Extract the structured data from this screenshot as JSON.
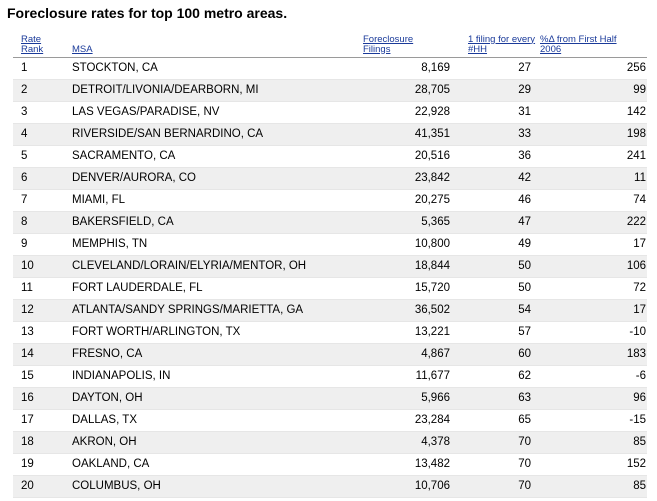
{
  "title": "Foreclosure rates for top 100 metro areas.",
  "columns": {
    "rank": "Rate\nRank",
    "msa": "MSA",
    "filings": "Foreclosure\nFilings",
    "per_hh": "1 filing for every\n#HH",
    "pct_change": "%Δ from First Half\n2006"
  },
  "rows": [
    {
      "rank": "1",
      "msa": "STOCKTON, CA",
      "filings": "8,169",
      "per_hh": "27",
      "pct_change": "256"
    },
    {
      "rank": "2",
      "msa": "DETROIT/LIVONIA/DEARBORN, MI",
      "filings": "28,705",
      "per_hh": "29",
      "pct_change": "99"
    },
    {
      "rank": "3",
      "msa": "LAS VEGAS/PARADISE, NV",
      "filings": "22,928",
      "per_hh": "31",
      "pct_change": "142"
    },
    {
      "rank": "4",
      "msa": "RIVERSIDE/SAN BERNARDINO, CA",
      "filings": "41,351",
      "per_hh": "33",
      "pct_change": "198"
    },
    {
      "rank": "5",
      "msa": "SACRAMENTO, CA",
      "filings": "20,516",
      "per_hh": "36",
      "pct_change": "241"
    },
    {
      "rank": "6",
      "msa": "DENVER/AURORA, CO",
      "filings": "23,842",
      "per_hh": "42",
      "pct_change": "11"
    },
    {
      "rank": "7",
      "msa": "MIAMI, FL",
      "filings": "20,275",
      "per_hh": "46",
      "pct_change": "74"
    },
    {
      "rank": "8",
      "msa": "BAKERSFIELD, CA",
      "filings": "5,365",
      "per_hh": "47",
      "pct_change": "222"
    },
    {
      "rank": "9",
      "msa": "MEMPHIS, TN",
      "filings": "10,800",
      "per_hh": "49",
      "pct_change": "17"
    },
    {
      "rank": "10",
      "msa": "CLEVELAND/LORAIN/ELYRIA/MENTOR, OH",
      "filings": "18,844",
      "per_hh": "50",
      "pct_change": "106"
    },
    {
      "rank": "11",
      "msa": "FORT LAUDERDALE, FL",
      "filings": "15,720",
      "per_hh": "50",
      "pct_change": "72"
    },
    {
      "rank": "12",
      "msa": "ATLANTA/SANDY SPRINGS/MARIETTA, GA",
      "filings": "36,502",
      "per_hh": "54",
      "pct_change": "17"
    },
    {
      "rank": "13",
      "msa": "FORT WORTH/ARLINGTON, TX",
      "filings": "13,221",
      "per_hh": "57",
      "pct_change": "-10"
    },
    {
      "rank": "14",
      "msa": "FRESNO, CA",
      "filings": "4,867",
      "per_hh": "60",
      "pct_change": "183"
    },
    {
      "rank": "15",
      "msa": "INDIANAPOLIS, IN",
      "filings": "11,677",
      "per_hh": "62",
      "pct_change": "-6"
    },
    {
      "rank": "16",
      "msa": "DAYTON, OH",
      "filings": "5,966",
      "per_hh": "63",
      "pct_change": "96"
    },
    {
      "rank": "17",
      "msa": "DALLAS, TX",
      "filings": "23,284",
      "per_hh": "65",
      "pct_change": "-15"
    },
    {
      "rank": "18",
      "msa": "AKRON, OH",
      "filings": "4,378",
      "per_hh": "70",
      "pct_change": "85"
    },
    {
      "rank": "19",
      "msa": "OAKLAND, CA",
      "filings": "13,482",
      "per_hh": "70",
      "pct_change": "152"
    },
    {
      "rank": "20",
      "msa": "COLUMBUS, OH",
      "filings": "10,706",
      "per_hh": "70",
      "pct_change": "85"
    }
  ]
}
